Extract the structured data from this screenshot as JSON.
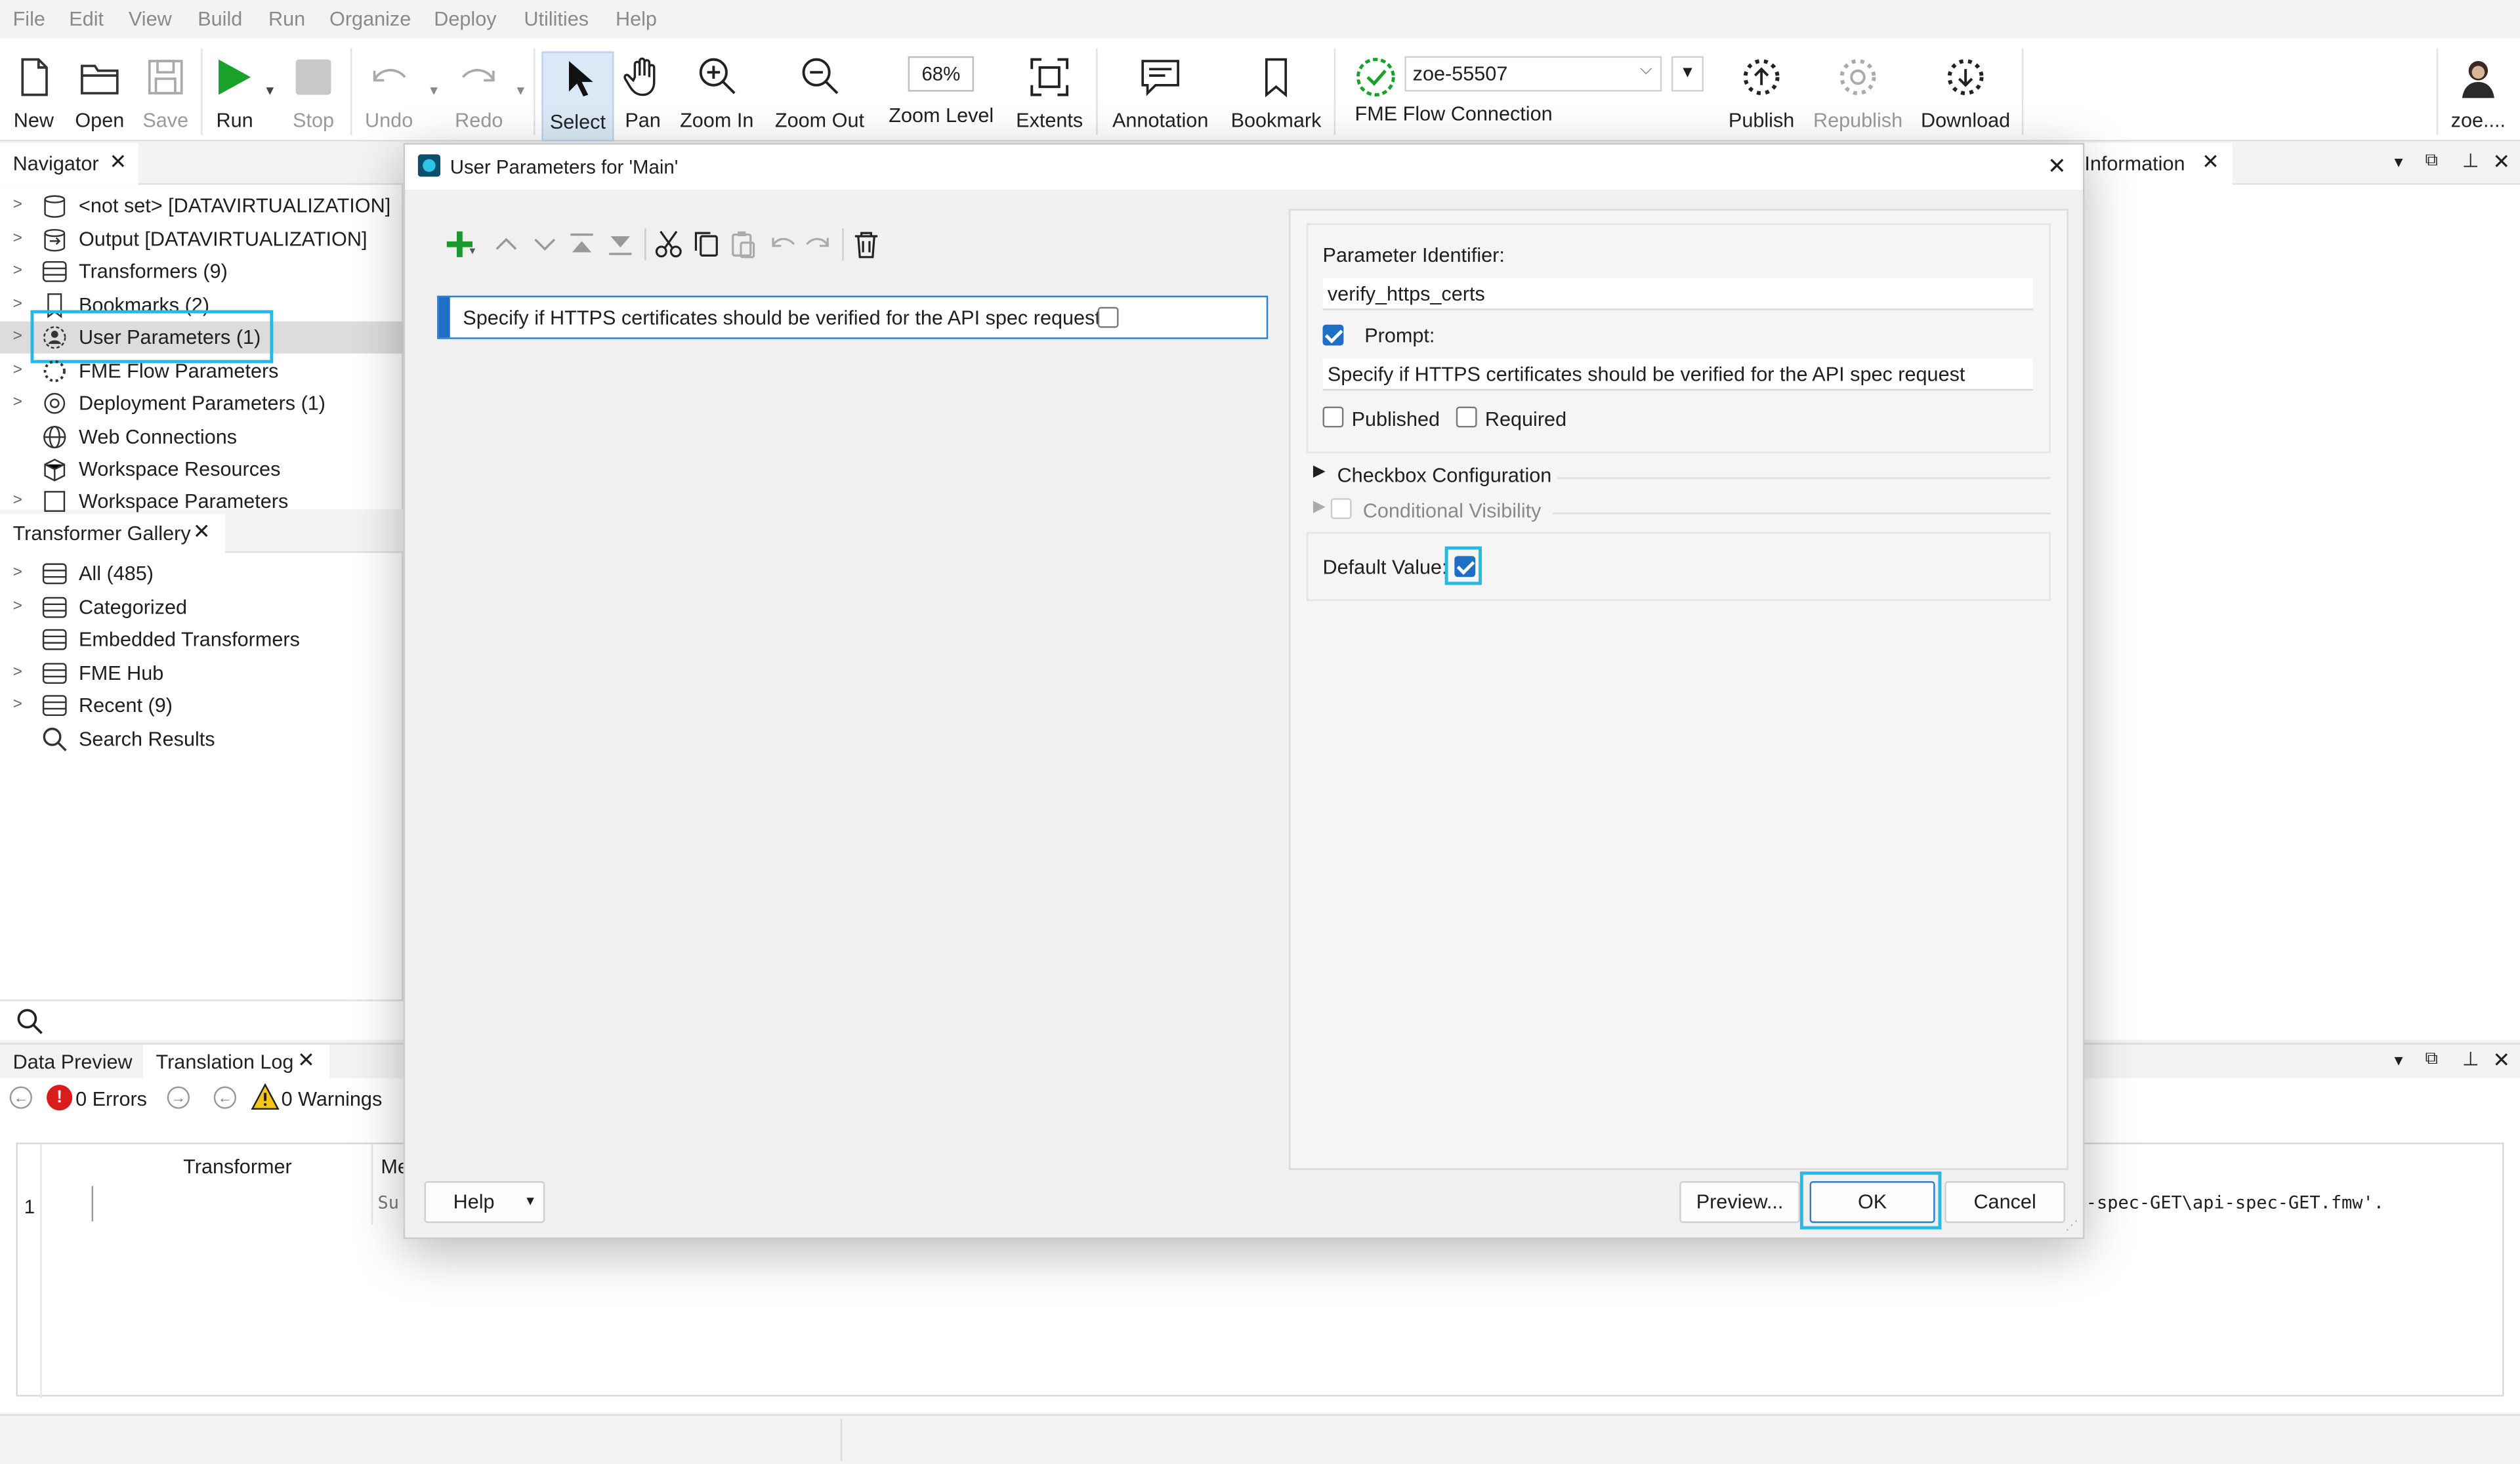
{
  "menu": [
    "File",
    "Edit",
    "View",
    "Build",
    "Run",
    "Organize",
    "Deploy",
    "Utilities",
    "Help"
  ],
  "toolbar": {
    "new": "New",
    "open": "Open",
    "save": "Save",
    "run": "Run",
    "stop": "Stop",
    "undo": "Undo",
    "redo": "Redo",
    "select": "Select",
    "pan": "Pan",
    "zoom_in": "Zoom In",
    "zoom_out": "Zoom Out",
    "zoom_value": "68%",
    "zoom_level": "Zoom Level",
    "extents": "Extents",
    "annotation": "Annotation",
    "bookmark": "Bookmark",
    "connection_value": "zoe-55507",
    "connection_label": "FME Flow Connection",
    "publish": "Publish",
    "republish": "Republish",
    "download": "Download",
    "user": "zoe...."
  },
  "navigator": {
    "title": "Navigator",
    "items": [
      "<not set> [DATAVIRTUALIZATION]",
      "Output [DATAVIRTUALIZATION]",
      "Transformers (9)",
      "Bookmarks (2)",
      "User Parameters (1)",
      "FME Flow Parameters",
      "Deployment Parameters (1)",
      "Web Connections",
      "Workspace Resources",
      "Workspace Parameters"
    ]
  },
  "gallery": {
    "title": "Transformer Gallery",
    "items": [
      "All (485)",
      "Categorized",
      "Embedded Transformers",
      "FME Hub",
      "Recent (9)",
      "Search Results"
    ]
  },
  "bottom": {
    "tab_preview": "Data Preview",
    "tab_log": "Translation Log",
    "errors": "0 Errors",
    "warnings": "0 Warnings",
    "col_transformer": "Transformer",
    "col_message": "Me",
    "row_num": "1",
    "row_message_start": "Su",
    "log_tail": "-spec-GET\\api-spec-GET.fmw'."
  },
  "right_panel": {
    "title": "Information"
  },
  "dialog": {
    "title": "User Parameters for 'Main'",
    "param_row": "Specify if HTTPS certificates should be verified for the API spec request:",
    "identifier_label": "Parameter Identifier:",
    "identifier_value": "verify_https_certs",
    "prompt_label": "Prompt:",
    "prompt_value": "Specify if HTTPS certificates should be verified for the API spec request",
    "published_label": "Published",
    "required_label": "Required",
    "checkbox_config": "Checkbox Configuration",
    "conditional_visibility": "Conditional Visibility",
    "default_value_label": "Default Value:",
    "help": "Help",
    "preview": "Preview...",
    "ok": "OK",
    "cancel": "Cancel"
  },
  "colors": {
    "accent": "#1f6fc5",
    "highlight": "#25b9e6",
    "run_green": "#1aa12b"
  }
}
